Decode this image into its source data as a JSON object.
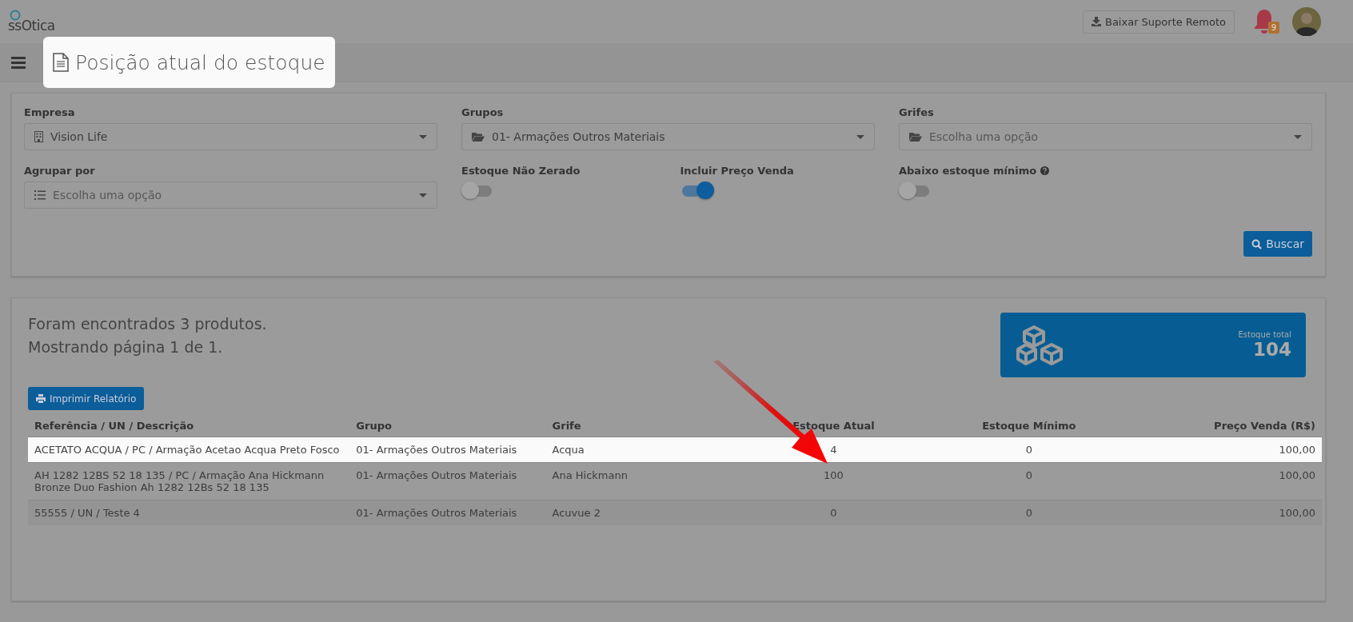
{
  "header": {
    "logo": "ssOtica",
    "support_button": "Baixar Suporte Remoto",
    "notification_count": "9"
  },
  "page_title": {
    "text": "Posição atual do estoque",
    "highlighted": true
  },
  "filters": [
    {
      "kind": "select",
      "label": "Empresa",
      "value": "Vision Life"
    },
    {
      "kind": "select",
      "label": "Grupos",
      "value": "01- Armações Outros Materiais"
    },
    {
      "kind": "select",
      "label": "Grifes",
      "placeholder": "Escolha uma opção"
    },
    {
      "kind": "select",
      "label": "Agrupar por",
      "placeholder": "Escolha uma opção"
    },
    {
      "kind": "toggle",
      "label": "Estoque Não Zerado",
      "on": false
    },
    {
      "kind": "toggle",
      "label": "Incluir Preço Venda",
      "on": true
    },
    {
      "kind": "toggle",
      "label": "Abaixo estoque mínimo",
      "on": false,
      "help": true
    }
  ],
  "search_button": "Buscar",
  "results": {
    "summary": [
      "Foram encontrados 3 produtos.",
      "Mostrando página 1 de 1."
    ],
    "stat": {
      "label": "Estoque total",
      "value": "104"
    },
    "print_button": "Imprimir Relatório",
    "columns": [
      "Referência / UN / Descrição",
      "Grupo",
      "Grife",
      "Estoque Atual",
      "Estoque Mínimo",
      "Preço Venda (R$)"
    ],
    "rows": [
      {
        "cells": [
          "ACETATO ACQUA / PC / Armação Acetao Acqua Preto Fosco",
          "01- Armações Outros Materiais",
          "Acqua",
          "4",
          "0",
          "100,00"
        ],
        "highlighted": true
      },
      {
        "cells": [
          "AH 1282 12BS 52 18 135 / PC / Armação Ana Hickmann Bronze Duo Fashion Ah 1282 12Bs 52 18 135",
          "01- Armações Outros Materiais",
          "Ana Hickmann",
          "100",
          "0",
          "100,00"
        ],
        "highlighted": false
      },
      {
        "cells": [
          "55555 / UN / Teste 4",
          "01- Armações Outros Materiais",
          "Acuvue 2",
          "0",
          "0",
          "100,00"
        ],
        "highlighted": false
      }
    ]
  },
  "annotation": {
    "kind": "arrow"
  }
}
